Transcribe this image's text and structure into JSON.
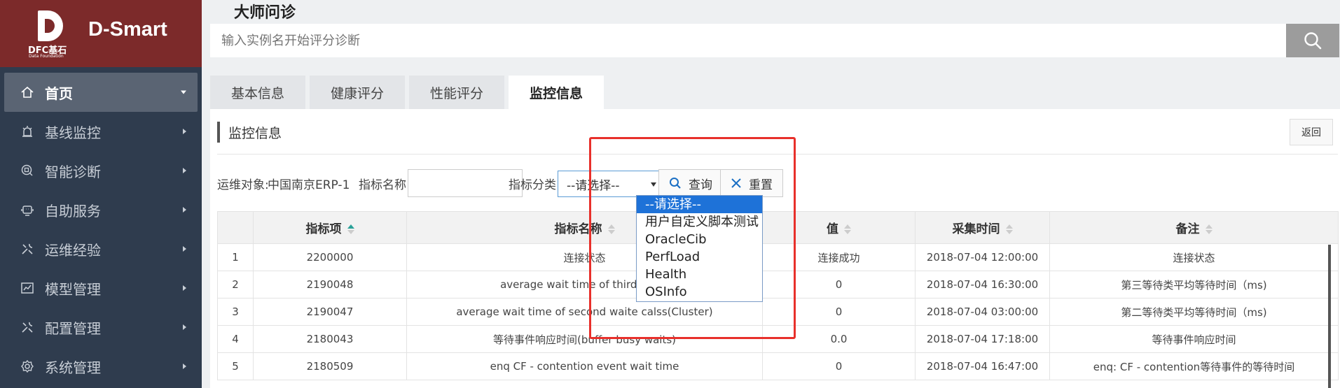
{
  "app": {
    "brand": "D-Smart",
    "logo_text": "DFC基石",
    "logo_sub": "Data Foundation"
  },
  "sidebar": {
    "items": [
      {
        "label": "首页",
        "icon": "home-icon",
        "active": true
      },
      {
        "label": "基线监控",
        "icon": "alarm-icon"
      },
      {
        "label": "智能诊断",
        "icon": "diagnose-icon"
      },
      {
        "label": "自助服务",
        "icon": "robot-icon"
      },
      {
        "label": "运维经验",
        "icon": "tools-icon"
      },
      {
        "label": "模型管理",
        "icon": "chart-icon"
      },
      {
        "label": "配置管理",
        "icon": "config-icon"
      },
      {
        "label": "系统管理",
        "icon": "gear-icon"
      }
    ]
  },
  "header": {
    "title": "大师问诊",
    "search_placeholder": "输入实例名开始评分诊断"
  },
  "tabs": [
    {
      "label": "基本信息"
    },
    {
      "label": "健康评分"
    },
    {
      "label": "性能评分"
    },
    {
      "label": "监控信息",
      "active": true
    }
  ],
  "panel": {
    "title": "监控信息",
    "back_label": "返回"
  },
  "filters": {
    "target_label": "运维对象:",
    "target_value": "中国南京ERP-1",
    "name_label": "指标名称:",
    "name_value": "",
    "category_label": "指标分类:",
    "category_value": "--请选择--",
    "query_label": "查询",
    "reset_label": "重置"
  },
  "dropdown": {
    "options": [
      "--请选择--",
      "用户自定义脚本测试",
      "OracleCib",
      "PerfLoad",
      "Health",
      "OSInfo"
    ],
    "selected_index": 0
  },
  "table": {
    "headers": [
      "",
      "指标项",
      "指标名称",
      "值",
      "采集时间",
      "备注"
    ],
    "rows": [
      [
        "1",
        "2200000",
        "连接状态",
        "连接成功",
        "2018-07-04 12:00:00",
        "连接状态"
      ],
      [
        "2",
        "2190048",
        "average wait time of third waite",
        "0",
        "2018-07-04 16:30:00",
        "第三等待类平均等待时间（ms)"
      ],
      [
        "3",
        "2190047",
        "average wait time of second waite calss(Cluster)",
        "0",
        "2018-07-04 03:00:00",
        "第二等待类平均等待时间（ms)"
      ],
      [
        "4",
        "2180043",
        "等待事件响应时间(buffer busy waits)",
        "0.0",
        "2018-07-04 17:18:00",
        "等待事件响应时间"
      ],
      [
        "5",
        "2180509",
        "enq CF - contention event wait time",
        "0",
        "2018-07-04 16:47:00",
        "enq: CF - contention等待事件的等待时间"
      ]
    ]
  },
  "colors": {
    "sidebar_bg": "#2f3c4e",
    "logo_bg": "#7c2a2a",
    "highlight": "#e8302b",
    "dropdown_selected": "#1e72d8"
  }
}
